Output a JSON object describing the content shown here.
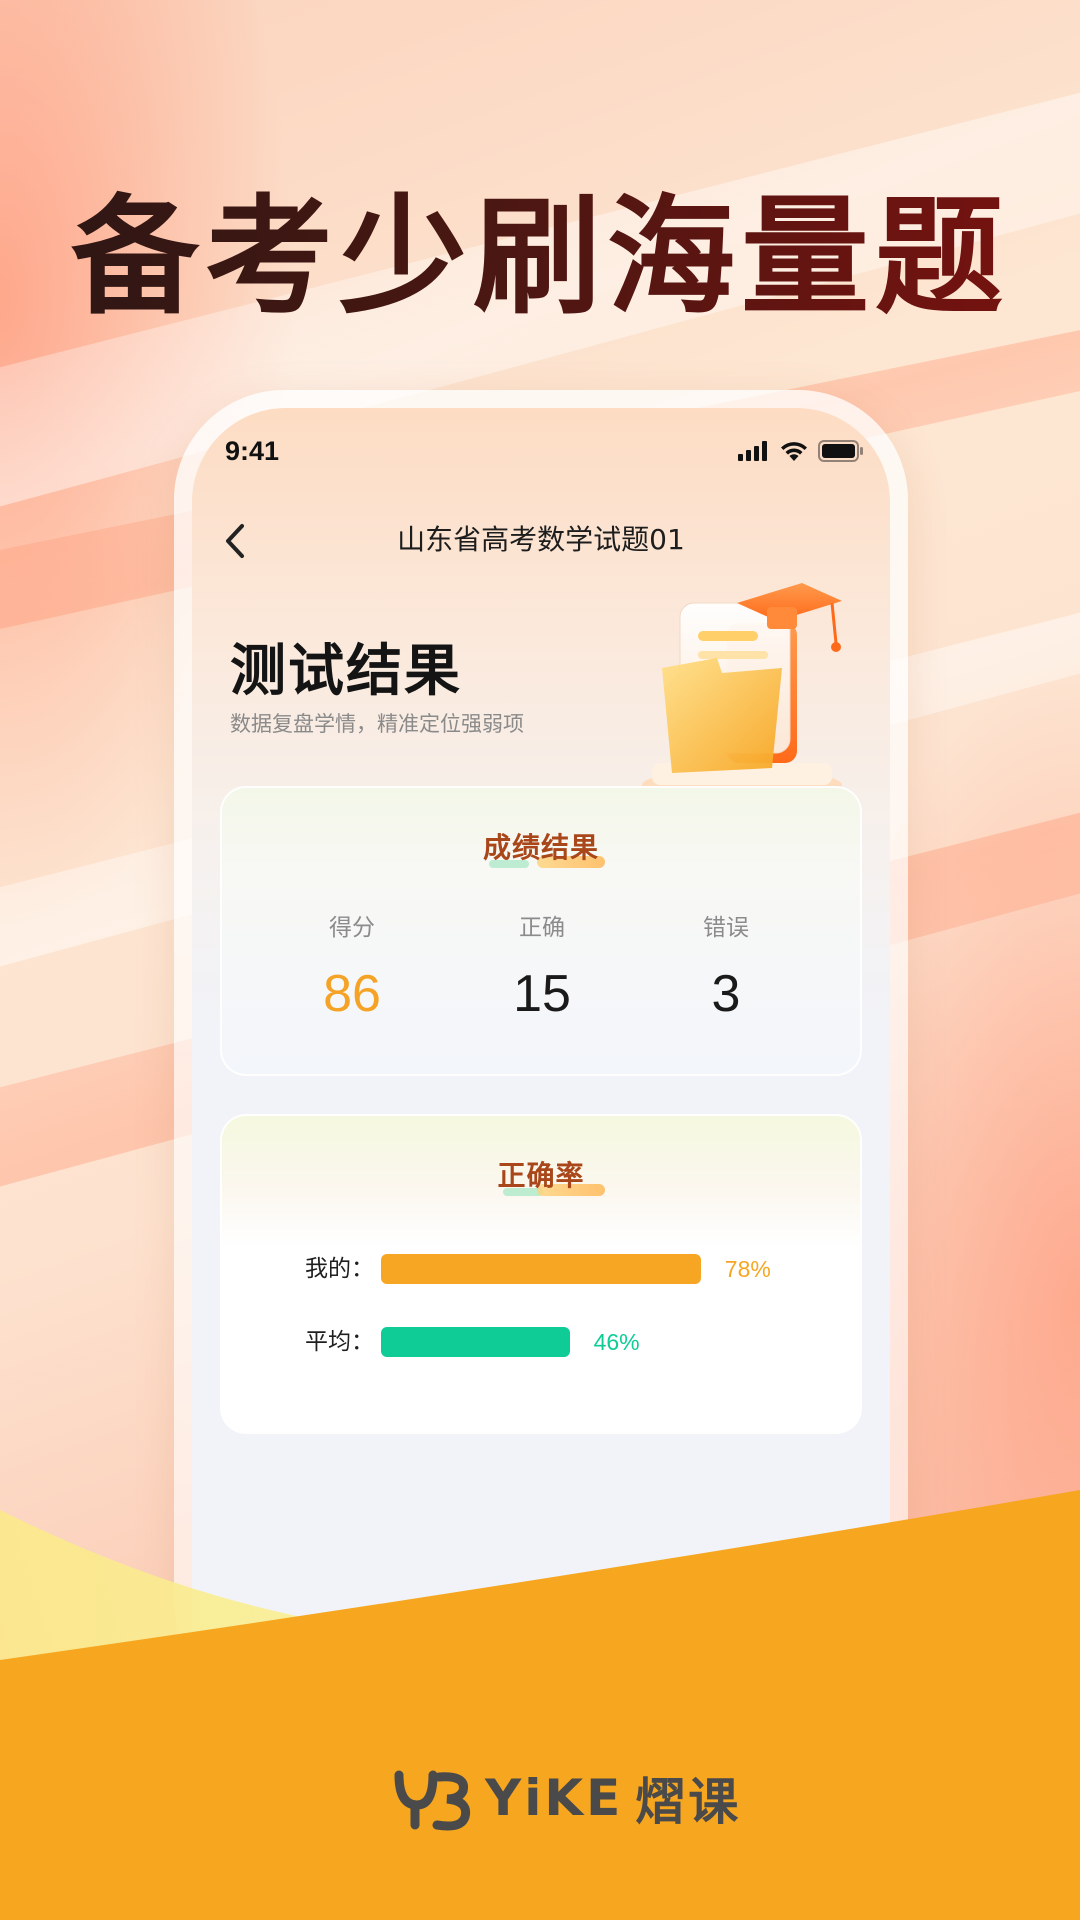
{
  "headline": "备考少刷海量题",
  "status_bar": {
    "time": "9:41"
  },
  "nav": {
    "title": "山东省高考数学试题01"
  },
  "hero": {
    "title": "测试结果",
    "subtitle": "数据复盘学情，精准定位强弱项"
  },
  "score_card": {
    "title": "成绩结果",
    "stats": [
      {
        "label": "得分",
        "value": "86"
      },
      {
        "label": "正确",
        "value": "15"
      },
      {
        "label": "错误",
        "value": "3"
      }
    ]
  },
  "accuracy_card": {
    "title": "正确率",
    "rows": [
      {
        "label": "我的：",
        "percent_text": "78%",
        "fraction": 0.78,
        "color": "#f7a623"
      },
      {
        "label": "平均：",
        "percent_text": "46%",
        "fraction": 0.46,
        "color": "#0fcc97"
      }
    ]
  },
  "brand": {
    "name_latin": "YiKE",
    "name_cn": "熠课"
  },
  "colors": {
    "accent_orange": "#f7a623",
    "accent_green": "#0fcc97",
    "headline_dark": "#4a1712"
  }
}
